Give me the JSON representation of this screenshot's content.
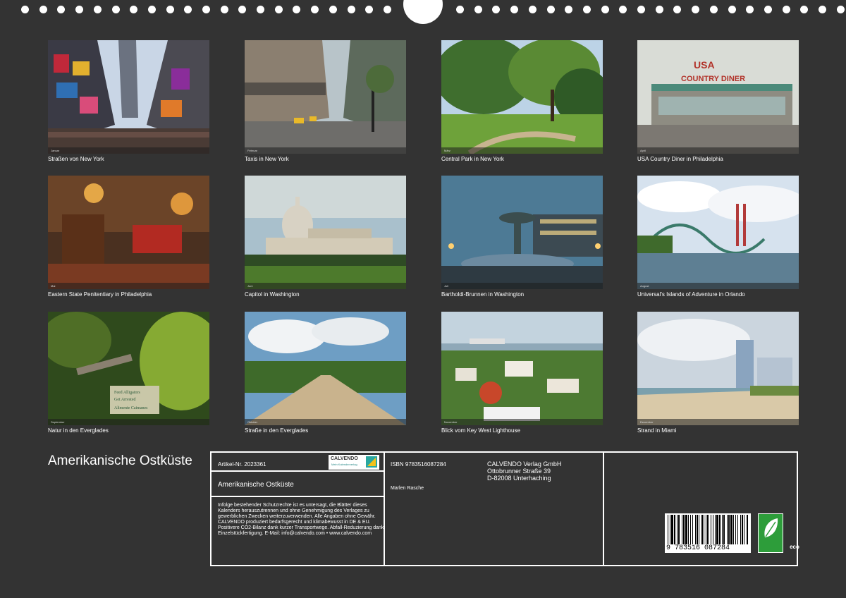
{
  "calendar_title": "Amerikanische Ostküste",
  "photos": [
    {
      "caption": "Straßen von New York",
      "month": "Januar",
      "scene": "times-square"
    },
    {
      "caption": "Taxis in New York",
      "month": "Februar",
      "scene": "street-taxis"
    },
    {
      "caption": "Central Park in New York",
      "month": "März",
      "scene": "park"
    },
    {
      "caption": "USA Country Diner in Philadelphia",
      "month": "April",
      "scene": "diner",
      "sign": "USA COUNTRY DINER"
    },
    {
      "caption": "Eastern State Penitentiary in Philadelphia",
      "month": "Mai",
      "scene": "room"
    },
    {
      "caption": "Capitol in Washington",
      "month": "Juni",
      "scene": "capitol"
    },
    {
      "caption": "Bartholdi-Brunnen in Washington",
      "month": "Juli",
      "scene": "fountain"
    },
    {
      "caption": "Universal's Islands of Adventure in Orlando",
      "month": "August",
      "scene": "coaster"
    },
    {
      "caption": "Natur in den Everglades",
      "month": "September",
      "scene": "everglades",
      "sign": "Feed Alligators / Get Arrested / Alimente Caimanes"
    },
    {
      "caption": "Straße in den Everglades",
      "month": "Oktober",
      "scene": "road"
    },
    {
      "caption": "Blick vom Key West Lighthouse",
      "month": "November",
      "scene": "keywest"
    },
    {
      "caption": "Strand in Miami",
      "month": "Dezember",
      "scene": "beach"
    }
  ],
  "info": {
    "article": "Artikel-Nr. 2023361",
    "isbn": "ISBN 9783516087284",
    "title": "Amerikanische Ostküste",
    "author": "Marlen Rasche",
    "publisher": [
      "CALVENDO Verlag GmbH",
      "Ottobrunner Straße 39",
      "D-82008 Unterhaching"
    ],
    "logo": "CALVENDO",
    "logo_sub": "Mein Kalenderverlag",
    "legal": "Infolge bestehender Schutzrechte ist es untersagt, die Blätter dieses Kalenders herauszutrennen und ohne Genehmigung des Verlages zu gewerblichen Zwecken weiterzuverwenden. Alle Angaben ohne Gewähr. CALVENDO produziert bedarfsgerecht und klimabewusst in DE & EU. Positivere CO2-Bilanz dank kurzer Transportwege. Abfall-Reduzierung dank Einzelstückfertigung. E-Mail: info@calvendo.com • www.calvendo.com",
    "barcode_number": "9  783516  087284",
    "eco_label": "eco"
  },
  "colors": {
    "background": "#333333",
    "border": "#ffffff",
    "eco": "#2d9d3a"
  }
}
